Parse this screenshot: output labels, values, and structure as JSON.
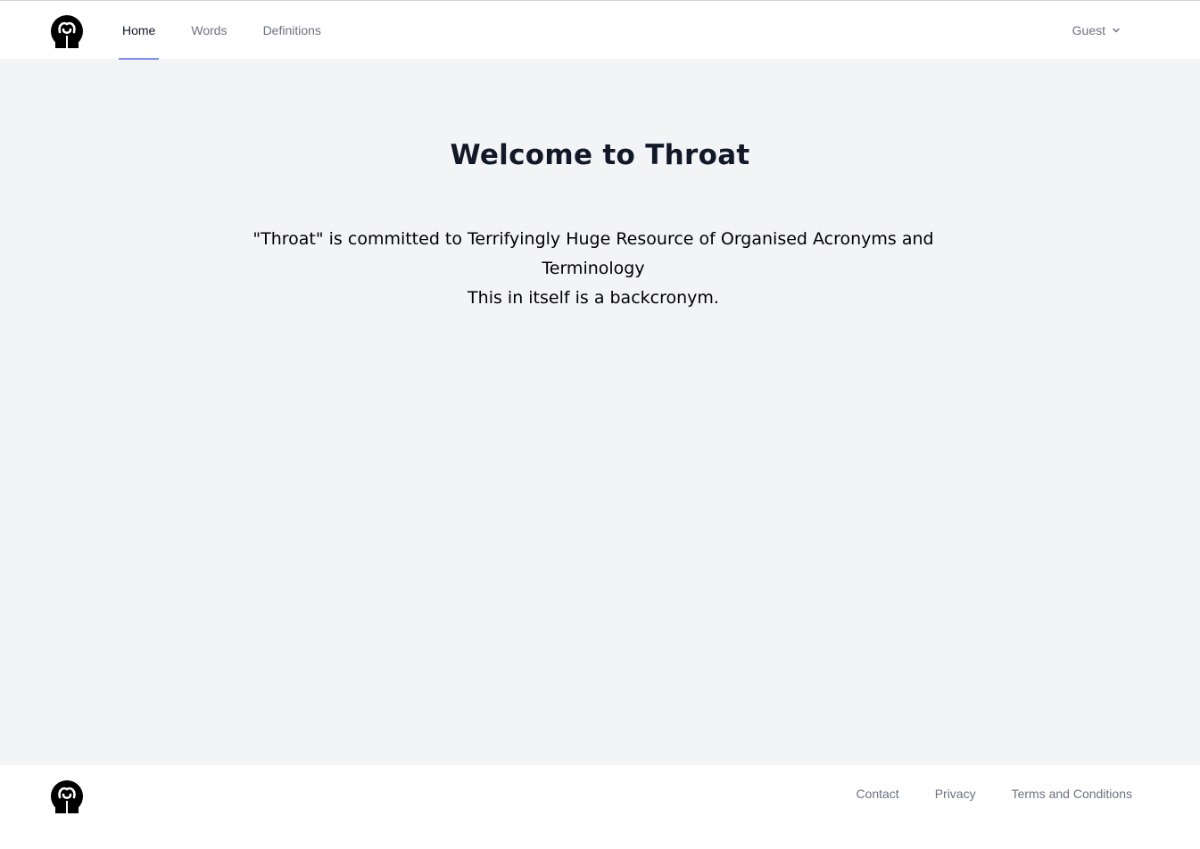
{
  "header": {
    "logo_icon": "throat-logo-icon",
    "nav": [
      {
        "label": "Home",
        "active": true
      },
      {
        "label": "Words",
        "active": false
      },
      {
        "label": "Definitions",
        "active": false
      }
    ],
    "user_menu": {
      "label": "Guest",
      "icon": "chevron-down-icon"
    }
  },
  "main": {
    "title": "Welcome to Throat",
    "intro_line1": "\"Throat\" is committed to Terrifyingly Huge Resource of Organised Acronyms and Terminology",
    "intro_line2": "This in itself is a backcronym."
  },
  "footer": {
    "logo_icon": "throat-logo-icon",
    "links": [
      "Contact",
      "Privacy",
      "Terms and Conditions"
    ]
  },
  "colors": {
    "page_bg": "#f3f4f6",
    "active_underline": "#818cf8",
    "nav_text": "#6b7280",
    "active_text": "#111827"
  }
}
